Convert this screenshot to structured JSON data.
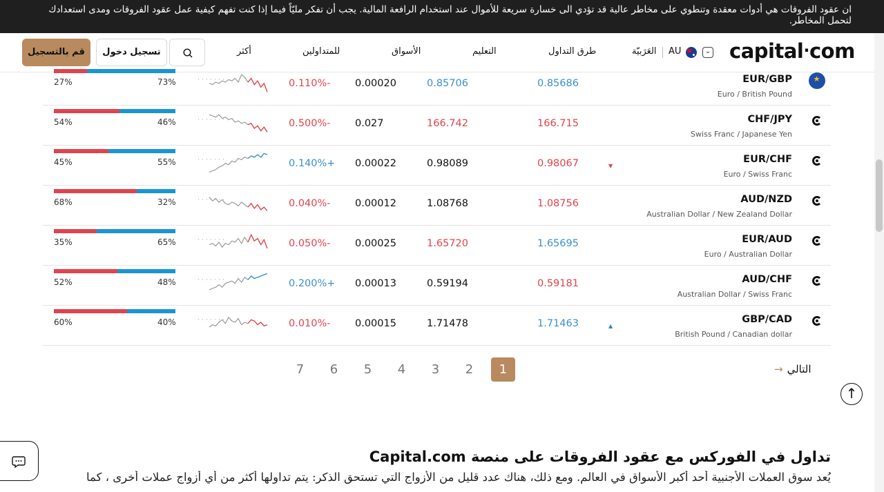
{
  "risk_banner": {
    "text": "ان عقود الفروقات هي أدوات معقدة وتنطوي على مخاطر عالية قد تؤدي الى خسارة سريعة للأموال عند استخدام الرافعة المالية. يجب أن تفكر مليّاً فيما إذا كنت تفهم كيفية عمل عقود الفروقات ومدى استعدادك لتحمل المخاطر."
  },
  "header": {
    "logo": "capital",
    "logo_suffix": "com",
    "region": "AU",
    "language": "العَرَبيّة",
    "nav": [
      {
        "label": "طرق التداول"
      },
      {
        "label": "التعليم"
      },
      {
        "label": "الأسواق"
      },
      {
        "label": "للمتداولين"
      },
      {
        "label": "أكثر"
      }
    ],
    "login_label": "تسجيل دخول",
    "signup_label": "قم بالتسجيل"
  },
  "colors": {
    "brand": "#b88a5e",
    "buy_blue": "#1a95d3",
    "sell_red": "#e0434d"
  },
  "markets": [
    {
      "icon": "eu-flag-icon",
      "pair": "EUR/GBP",
      "desc": "Euro / British Pound",
      "sell": "0.85686",
      "sell_color": "blue",
      "buy": "0.85706",
      "buy_color": "blue",
      "spread": "0.00020",
      "change": "0.110%-",
      "change_dir": "down",
      "indicator": "",
      "sell_pct": 27,
      "sell_pct_label": "27%",
      "buy_pct_label": "73%"
    },
    {
      "icon": "capital-icon",
      "pair": "CHF/JPY",
      "desc": "Swiss Franc / Japanese Yen",
      "sell": "166.715",
      "sell_color": "red",
      "buy": "166.742",
      "buy_color": "red",
      "spread": "0.027",
      "change": "0.500%-",
      "change_dir": "down",
      "indicator": "",
      "sell_pct": 54,
      "sell_pct_label": "54%",
      "buy_pct_label": "46%"
    },
    {
      "icon": "capital-icon",
      "pair": "EUR/CHF",
      "desc": "Euro / Swiss Franc",
      "sell": "0.98067",
      "sell_color": "red",
      "buy": "0.98089",
      "buy_color": "black",
      "spread": "0.00022",
      "change": "0.140%+",
      "change_dir": "up",
      "indicator": "down",
      "sell_pct": 45,
      "sell_pct_label": "45%",
      "buy_pct_label": "55%"
    },
    {
      "icon": "capital-icon",
      "pair": "AUD/NZD",
      "desc": "Australian Dollar / New Zealand Dollar",
      "sell": "1.08756",
      "sell_color": "red",
      "buy": "1.08768",
      "buy_color": "black",
      "spread": "0.00012",
      "change": "0.040%-",
      "change_dir": "down",
      "indicator": "",
      "sell_pct": 68,
      "sell_pct_label": "68%",
      "buy_pct_label": "32%"
    },
    {
      "icon": "capital-icon",
      "pair": "EUR/AUD",
      "desc": "Euro / Australian Dollar",
      "sell": "1.65695",
      "sell_color": "blue",
      "buy": "1.65720",
      "buy_color": "red",
      "spread": "0.00025",
      "change": "0.050%-",
      "change_dir": "down",
      "indicator": "",
      "sell_pct": 35,
      "sell_pct_label": "35%",
      "buy_pct_label": "65%"
    },
    {
      "icon": "capital-icon",
      "pair": "AUD/CHF",
      "desc": "Australian Dollar / Swiss Franc",
      "sell": "0.59181",
      "sell_color": "red",
      "buy": "0.59194",
      "buy_color": "black",
      "spread": "0.00013",
      "change": "0.200%+",
      "change_dir": "up",
      "indicator": "",
      "sell_pct": 52,
      "sell_pct_label": "52%",
      "buy_pct_label": "48%"
    },
    {
      "icon": "capital-icon",
      "pair": "GBP/CAD",
      "desc": "British Pound / Canadian dollar",
      "sell": "1.71463",
      "sell_color": "blue",
      "buy": "1.71478",
      "buy_color": "black",
      "spread": "0.00015",
      "change": "0.010%-",
      "change_dir": "down",
      "indicator": "up",
      "sell_pct": 60,
      "sell_pct_label": "60%",
      "buy_pct_label": "40%"
    }
  ],
  "pagination": {
    "pages": [
      "7",
      "6",
      "5",
      "4",
      "3",
      "2",
      "1"
    ],
    "active": "1",
    "next_label": "التالي"
  },
  "section": {
    "title": "تداول في الفوركس مع عقود الفروقات على منصة Capital.com",
    "body": "يُعد سوق العملات الأجنبية أحد أكبر الأسواق في العالم. ومع ذلك، هناك عدد قليل من الأزواج التي تستحق الذكر: يتم تداولها أكثر من أي أزواج عملات أخرى ، كما"
  }
}
